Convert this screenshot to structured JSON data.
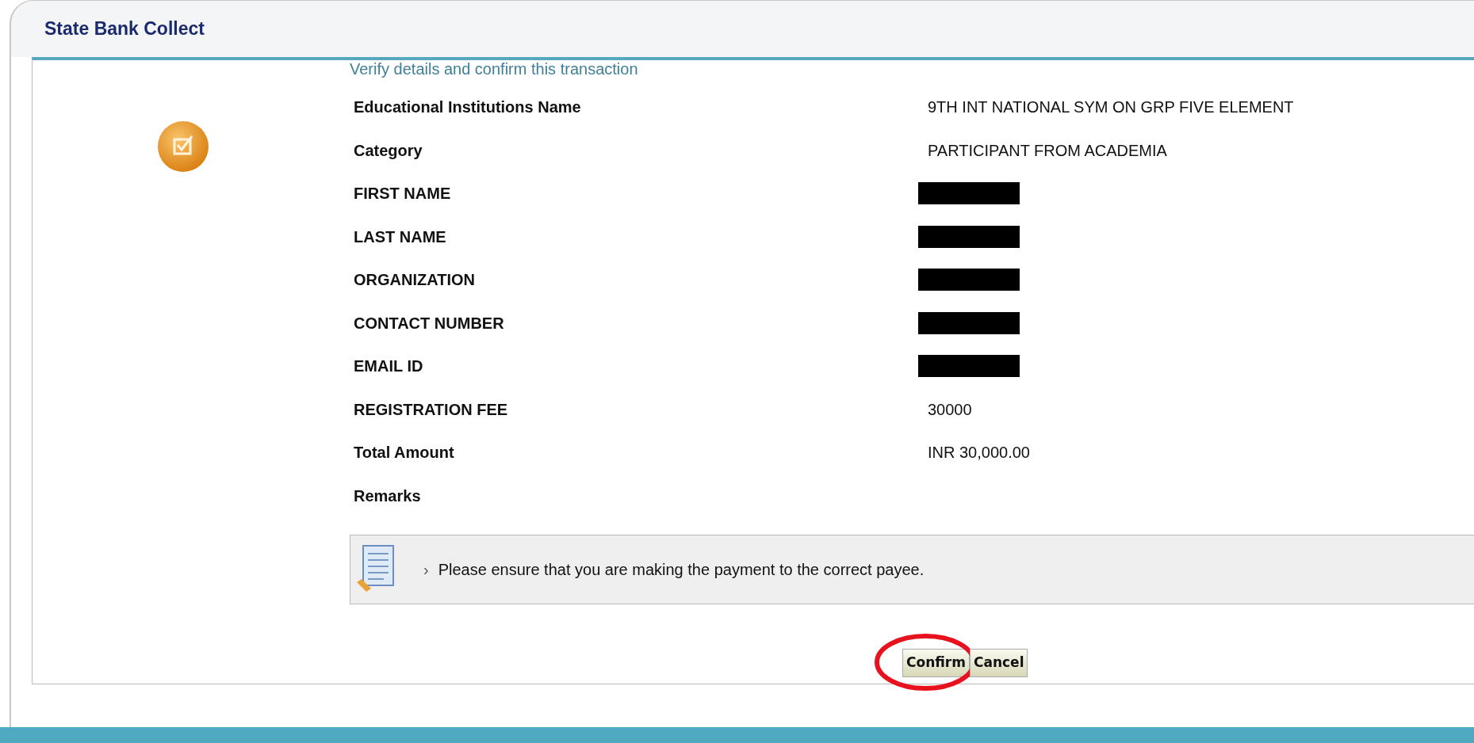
{
  "header": {
    "title": "State Bank Collect"
  },
  "form": {
    "heading": "Verify details and confirm this transaction",
    "rows": [
      {
        "label": "Educational Institutions Name",
        "kind": "text",
        "value": "9TH INT NATIONAL SYM ON GRP FIVE ELEMENT"
      },
      {
        "label": "Category",
        "kind": "text",
        "value": "PARTICIPANT FROM ACADEMIA"
      },
      {
        "label": "FIRST NAME",
        "kind": "redacted"
      },
      {
        "label": "LAST NAME",
        "kind": "redacted"
      },
      {
        "label": "ORGANIZATION",
        "kind": "redacted"
      },
      {
        "label": "CONTACT NUMBER",
        "kind": "redacted"
      },
      {
        "label": "EMAIL ID",
        "kind": "redacted"
      },
      {
        "label": "REGISTRATION FEE",
        "kind": "text",
        "value": "30000"
      },
      {
        "label": "Total Amount",
        "kind": "text",
        "value": "INR 30,000.00"
      },
      {
        "label": "Remarks",
        "kind": "empty"
      }
    ]
  },
  "notice": {
    "bullet": "›",
    "text": "Please ensure that you are making the payment to the correct payee."
  },
  "buttons": [
    {
      "label": "Confirm",
      "circled": true
    },
    {
      "label": "Cancel",
      "circled": false
    }
  ]
}
